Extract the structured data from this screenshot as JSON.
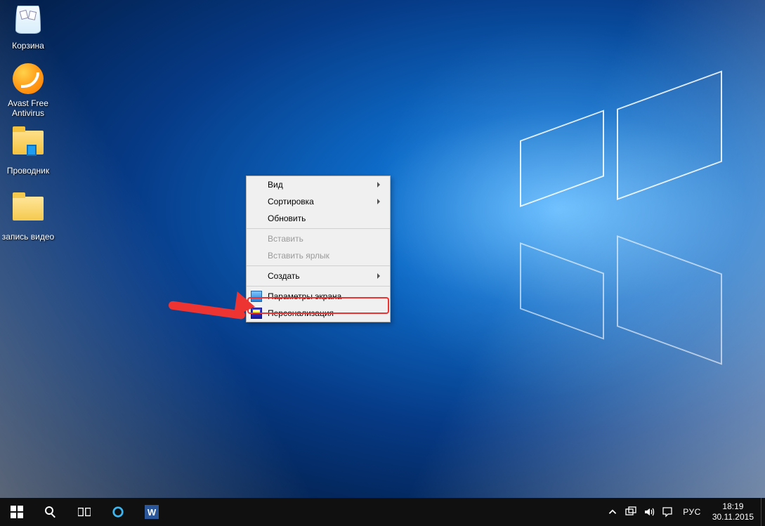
{
  "desktop_icons": [
    {
      "id": "recycle-bin",
      "label": "Корзина"
    },
    {
      "id": "avast",
      "label": "Avast Free\nAntivirus"
    },
    {
      "id": "explorer",
      "label": "Проводник"
    },
    {
      "id": "videos",
      "label": "запись видео"
    }
  ],
  "context_menu": {
    "view": "Вид",
    "sort": "Сортировка",
    "refresh": "Обновить",
    "paste": "Вставить",
    "paste_shortcut": "Вставить ярлык",
    "new": "Создать",
    "display_settings": "Параметры экрана",
    "personalize": "Персонализация"
  },
  "taskbar": {
    "lang": "РУС",
    "time": "18:19",
    "date": "30.11.2015"
  }
}
